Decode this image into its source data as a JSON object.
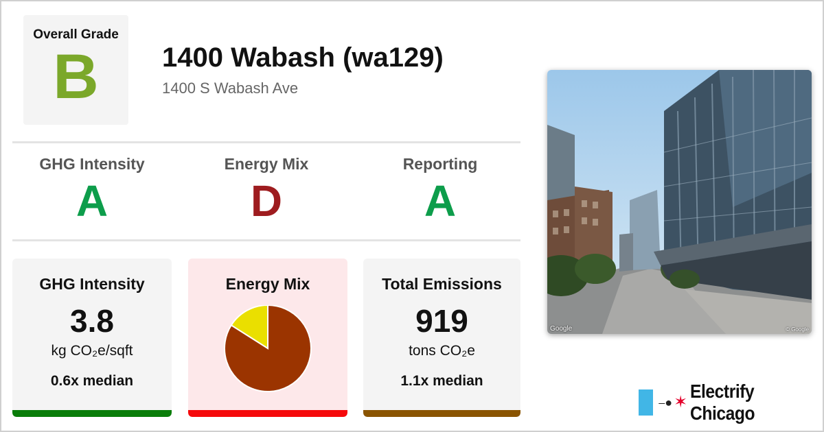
{
  "overall": {
    "label": "Overall Grade",
    "grade": "B",
    "color": "#7ba82a"
  },
  "building": {
    "name": "1400 Wabash (wa129)",
    "address": "1400 S Wabash Ave"
  },
  "subgrades": [
    {
      "label": "GHG Intensity",
      "grade": "A",
      "color": "#0d9d4b"
    },
    {
      "label": "Energy Mix",
      "grade": "D",
      "color": "#9e1c1f"
    },
    {
      "label": "Reporting",
      "grade": "A",
      "color": "#0d9d4b"
    }
  ],
  "cards": [
    {
      "title": "GHG Intensity",
      "value": "3.8",
      "unit": "kg CO₂e/sqft",
      "median": "0.6x median",
      "bg": "#f4f4f4",
      "bar_color": "#0a7d0a"
    },
    {
      "title": "Energy Mix",
      "bg": "#fde8ea",
      "bar_color": "#f5090b"
    },
    {
      "title": "Total Emissions",
      "value": "919",
      "unit": "tons CO₂e",
      "median": "1.1x median",
      "bg": "#f4f4f4",
      "bar_color": "#8a5400"
    }
  ],
  "chart_data": {
    "type": "pie",
    "categories": [
      "",
      ""
    ],
    "values": [
      84,
      16
    ],
    "colors": [
      "#9b3400",
      "#eadf00"
    ]
  },
  "photo": {
    "credit": "Google",
    "copyright": "© Google"
  },
  "brand": {
    "name": "Electrify Chicago",
    "plug_icon": "plug-icon",
    "star_icon": "star-icon",
    "flag_color": "#41b6e6",
    "star_color": "#e4002b"
  }
}
